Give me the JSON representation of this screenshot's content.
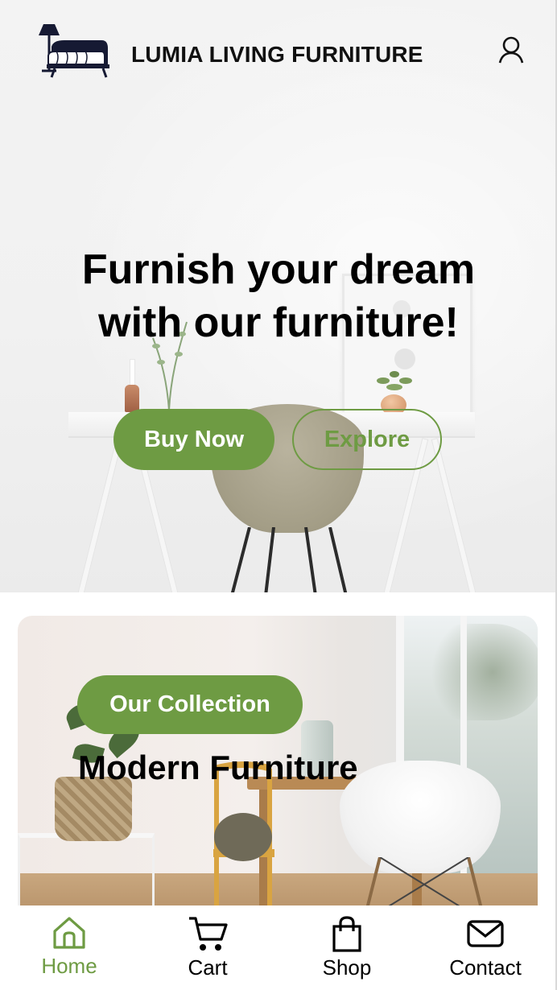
{
  "header": {
    "brand": "LUMIA LIVING FURNITURE",
    "logo_icon": "sofa-lamp-logo",
    "account_icon": "user-icon"
  },
  "hero": {
    "headline_line1": "Furnish your dream",
    "headline_line2": "with our furniture!",
    "primary_button": "Buy Now",
    "secondary_button": "Explore"
  },
  "collection": {
    "badge": "Our Collection",
    "title": "Modern Furniture"
  },
  "bottom_nav": {
    "items": [
      {
        "label": "Home",
        "icon": "home-icon",
        "active": true
      },
      {
        "label": "Cart",
        "icon": "cart-icon",
        "active": false
      },
      {
        "label": "Shop",
        "icon": "bag-icon",
        "active": false
      },
      {
        "label": "Contact",
        "icon": "mail-icon",
        "active": false
      }
    ]
  },
  "colors": {
    "accent": "#6e9b43",
    "text": "#000000",
    "background": "#ffffff"
  }
}
